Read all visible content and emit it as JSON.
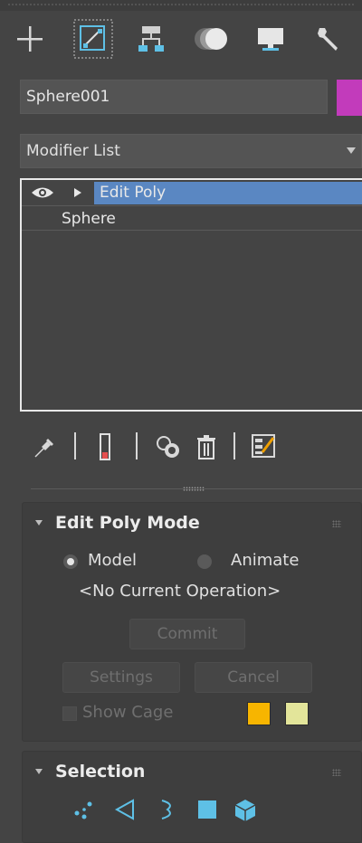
{
  "command_tabs": [
    {
      "name": "create",
      "icon": "plus-icon"
    },
    {
      "name": "modify",
      "icon": "modify-icon",
      "active": true
    },
    {
      "name": "hierarchy",
      "icon": "hierarchy-icon"
    },
    {
      "name": "motion",
      "icon": "motion-icon"
    },
    {
      "name": "display",
      "icon": "display-icon"
    },
    {
      "name": "utilities",
      "icon": "wrench-icon"
    }
  ],
  "object": {
    "name": "Sphere001",
    "color": "#c23bbb"
  },
  "modifier_list": {
    "label": "Modifier List"
  },
  "stack": {
    "items": [
      {
        "label": "Edit Poly",
        "selected": true
      },
      {
        "label": "Sphere"
      }
    ]
  },
  "stack_toolbar": {
    "icons": [
      "pin-stack-icon",
      "show-end-result-icon",
      "make-unique-icon",
      "remove-modifier-icon",
      "configure-modifier-sets-icon"
    ]
  },
  "edit_poly_mode": {
    "title": "Edit Poly Mode",
    "radio_model": "Model",
    "radio_animate": "Animate",
    "current_operation": "<No Current Operation>",
    "commit": "Commit",
    "settings": "Settings",
    "cancel": "Cancel",
    "show_cage": "Show Cage",
    "cage_color_1": "#f7b500",
    "cage_color_2": "#e3e59a"
  },
  "selection": {
    "title": "Selection",
    "icons": [
      "vertex-icon",
      "edge-icon",
      "border-icon",
      "polygon-icon",
      "element-icon"
    ]
  },
  "colors": {
    "accent": "#5a87c2",
    "selection_icons": "#5ec0e6"
  }
}
